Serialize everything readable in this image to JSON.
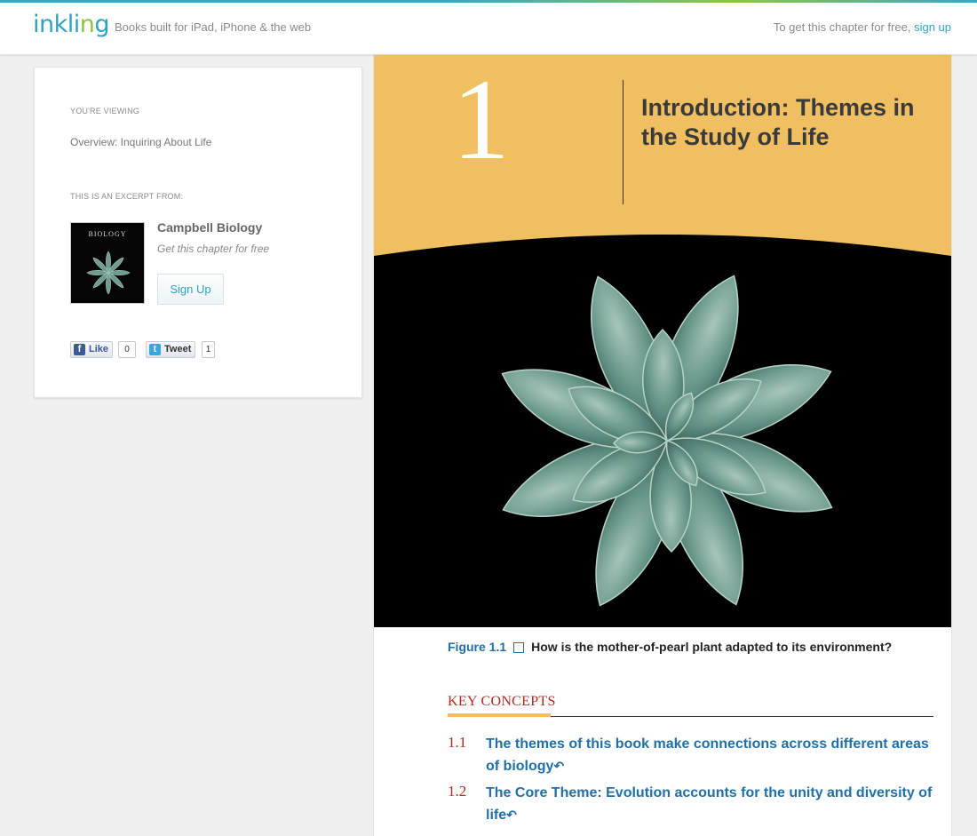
{
  "header": {
    "logo_text": "inkling",
    "tagline": "Books built for iPad, iPhone & the web",
    "cta_prefix": "To get this chapter for free,",
    "cta_link": "sign up"
  },
  "sidebar": {
    "viewing_label": "YOU'RE VIEWING",
    "viewing_title": "Overview: Inquiring About Life",
    "excerpt_label": "THIS IS AN EXCERPT FROM:",
    "cover_title": "BIOLOGY",
    "book_title": "Campbell Biology",
    "book_subtitle": "Get this chapter for free",
    "signup_button": "Sign Up",
    "like_label": "Like",
    "like_count": "0",
    "tweet_label": "Tweet",
    "tweet_count": "1"
  },
  "chapter": {
    "number": "1",
    "title": "Introduction: Themes in the Study of Life",
    "figure_label": "Figure 1.1",
    "figure_caption": "How is the mother-of-pearl plant adapted to its environment?",
    "key_concepts_heading": "KEY CONCEPTS",
    "concepts": [
      {
        "num": "1.1",
        "text": "The themes of this book make connections across different areas of biology"
      },
      {
        "num": "1.2",
        "text": "The Core Theme: Evolution accounts for the unity and diversity of life"
      }
    ]
  },
  "colors": {
    "accent": "#2fa3c2",
    "banner": "#f0bf62",
    "concept_blue": "#1f6fa8",
    "concept_red": "#b3291f"
  }
}
